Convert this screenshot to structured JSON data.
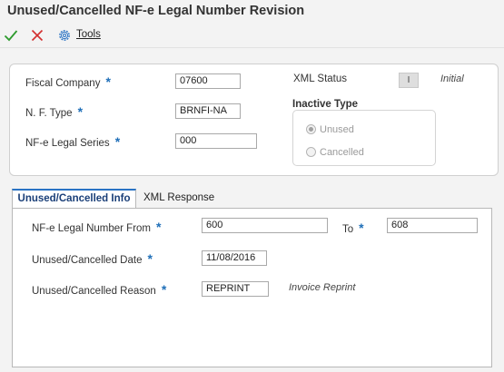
{
  "window": {
    "title": "Unused/Cancelled NF-e Legal Number Revision"
  },
  "toolbar": {
    "ok_icon": "check-icon",
    "cancel_icon": "close-icon",
    "tools_icon": "gear-icon",
    "tools_label": "Tools"
  },
  "header": {
    "fiscal_company": {
      "label": "Fiscal Company",
      "required_mark": "*",
      "value": "07600"
    },
    "nf_type": {
      "label": "N. F. Type",
      "required_mark": "*",
      "value": "BRNFI-NA"
    },
    "legal_series": {
      "label": "NF-e Legal Series",
      "required_mark": "*",
      "value": "000"
    },
    "xml_status": {
      "label": "XML Status",
      "code": "I",
      "description": "Initial"
    },
    "inactive_type": {
      "label": "Inactive Type",
      "options": [
        {
          "label": "Unused",
          "selected": true
        },
        {
          "label": "Cancelled",
          "selected": false
        }
      ]
    }
  },
  "tabs": [
    {
      "label": "Unused/Cancelled Info",
      "active": true
    },
    {
      "label": "XML Response",
      "active": false
    }
  ],
  "info": {
    "legal_number_from": {
      "label": "NF-e Legal Number From",
      "required_mark": "*",
      "value": "600"
    },
    "legal_number_to": {
      "label": "To",
      "required_mark": "*",
      "value": "608"
    },
    "date": {
      "label": "Unused/Cancelled Date",
      "required_mark": "*",
      "value": "11/08/2016"
    },
    "reason": {
      "label": "Unused/Cancelled Reason",
      "required_mark": "*",
      "value": "REPRINT",
      "description": "Invoice Reprint"
    }
  },
  "colors": {
    "accent": "#2a73c4",
    "required": "#1f6fb8",
    "ok": "#2e9b2e",
    "cancel": "#d32f2f"
  }
}
